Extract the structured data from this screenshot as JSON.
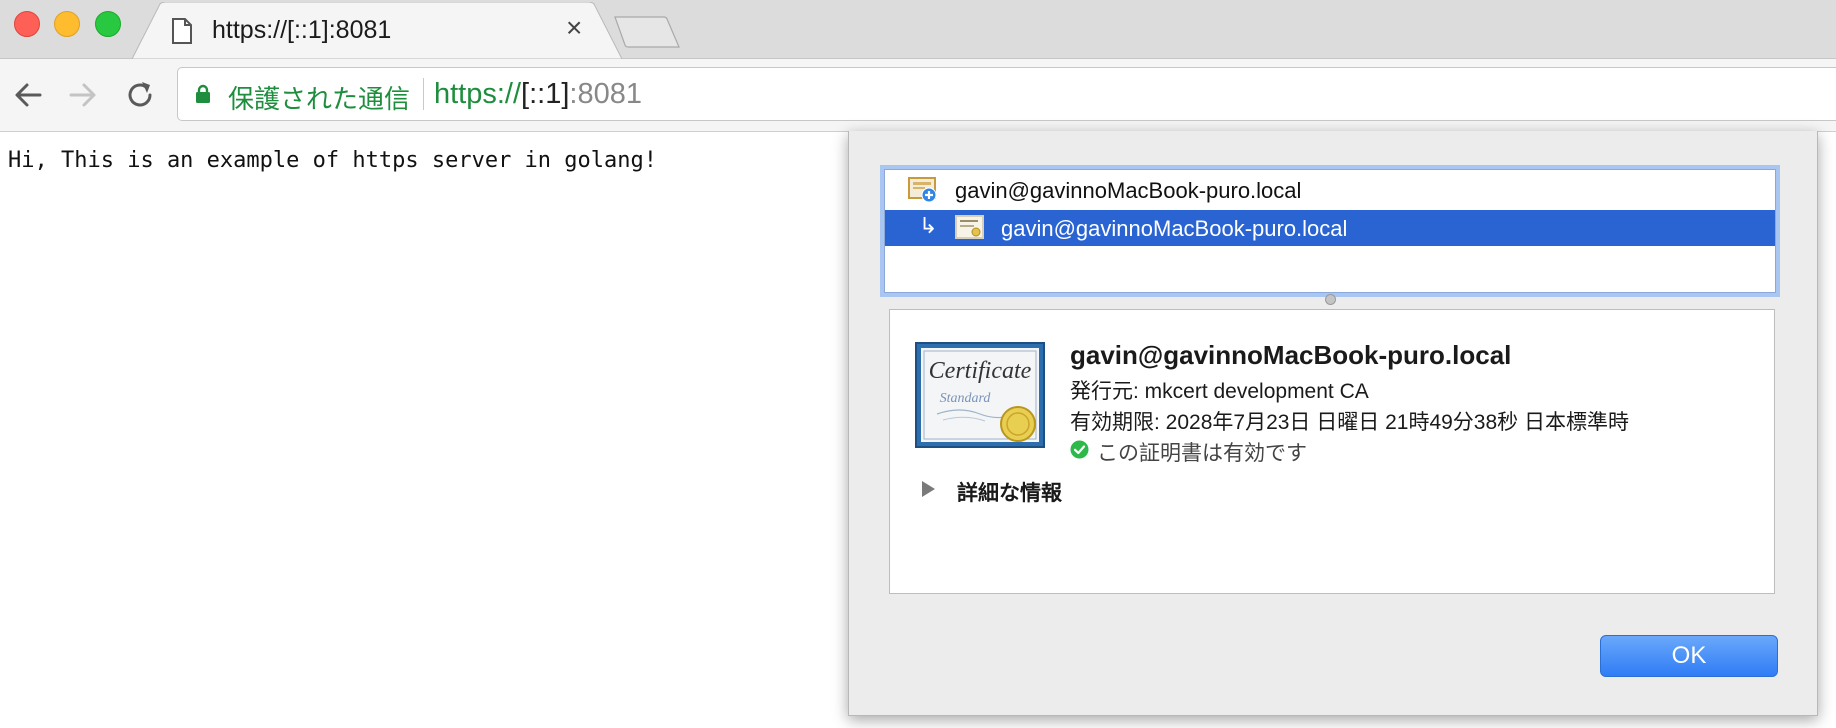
{
  "window": {
    "traffic_lights": {
      "close_color": "#fe5f57",
      "minimize_color": "#febc2e",
      "maximize_color": "#28c840"
    }
  },
  "tab": {
    "title": "https://[::1]:8081",
    "close_glyph": "×",
    "icon": "page-icon"
  },
  "toolbar": {
    "back_icon": "arrow-left-icon",
    "forward_icon": "arrow-right-icon",
    "reload_icon": "reload-icon",
    "secure_label": "保護された通信",
    "url": {
      "scheme": "https://",
      "host": "[::1]",
      "port": ":8081"
    },
    "secure_color": "#1e8e3e"
  },
  "page": {
    "text": "Hi, This is an example of https server in golang!"
  },
  "cert_dialog": {
    "tree": [
      {
        "label": "gavin@gavinnoMacBook-puro.local",
        "icon": "root-certificate-icon",
        "selected": false
      },
      {
        "label": "gavin@gavinnoMacBook-puro.local",
        "icon": "certificate-icon",
        "selected": true
      }
    ],
    "child_arrow": "↳",
    "details": {
      "name": "gavin@gavinnoMacBook-puro.local",
      "issuer": "発行元: mkcert development CA",
      "expiry": "有効期限: 2028年7月23日 日曜日 21時49分38秒 日本標準時",
      "validity": "この証明書は有効です",
      "more_info": "詳細な情報",
      "certificate_image_text": {
        "title": "Certificate",
        "subtitle": "Standard"
      }
    },
    "ok_label": "OK",
    "selection_color": "#2a64d2"
  }
}
